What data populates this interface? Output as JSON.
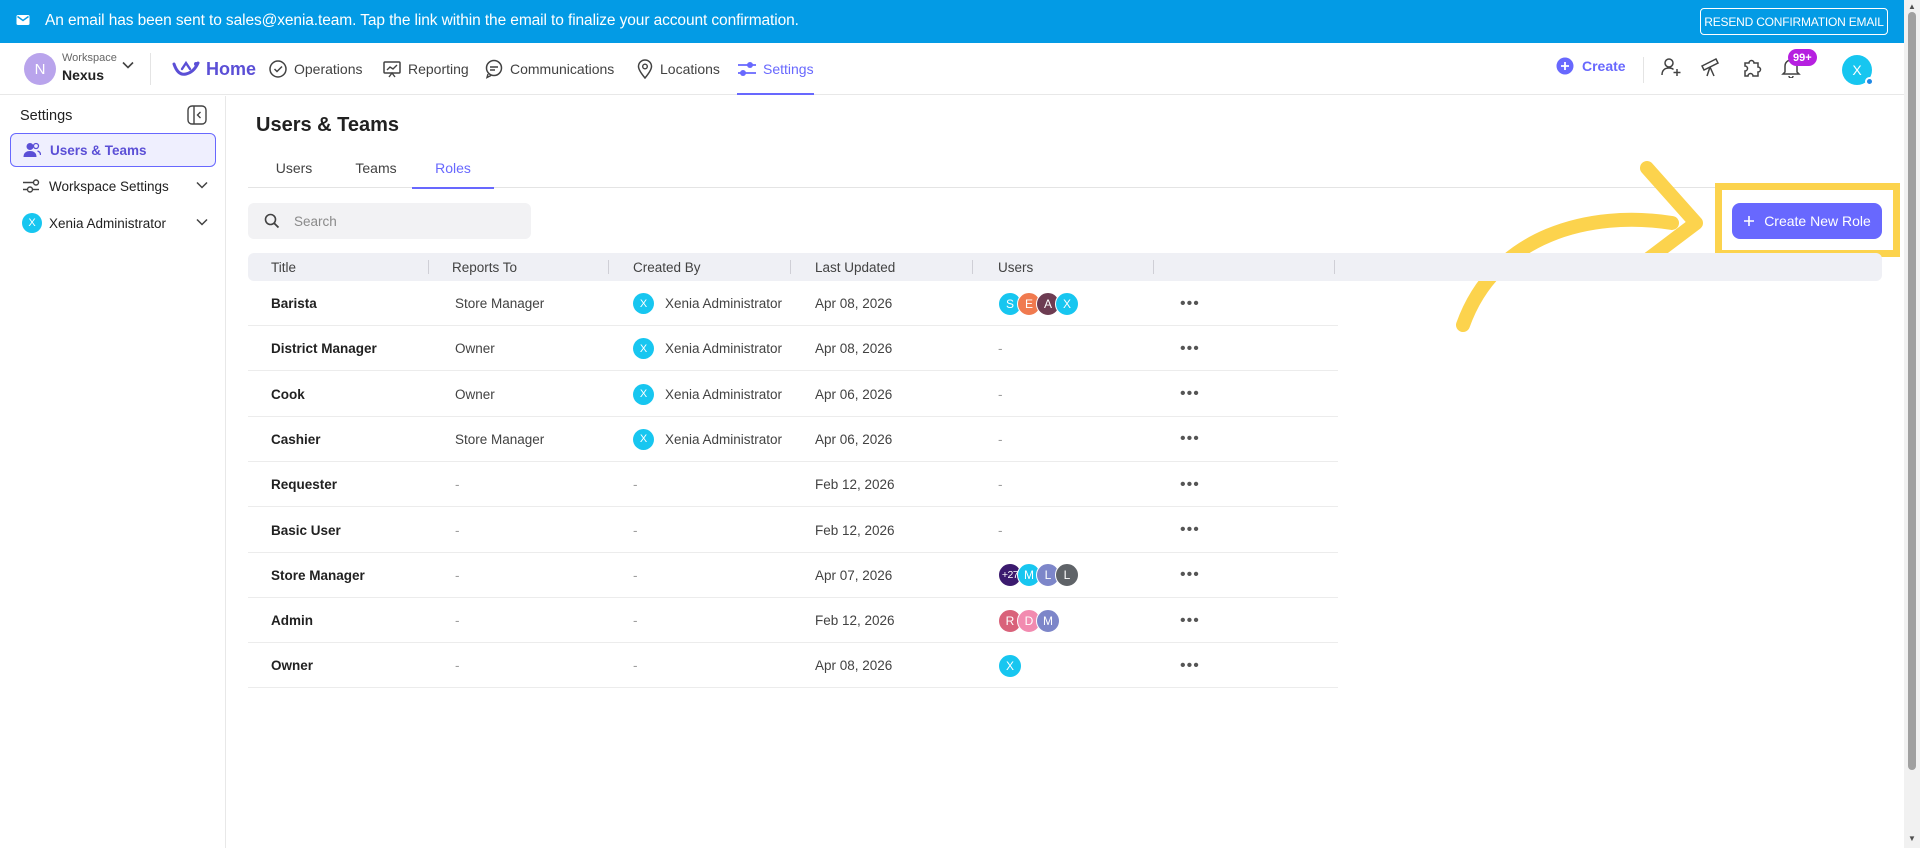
{
  "banner": {
    "message": "An email has been sent to sales@xenia.team. Tap the link within the email to finalize your account confirmation.",
    "resend_label": "RESEND CONFIRMATION EMAIL"
  },
  "navbar": {
    "workspace_label": "Workspace",
    "workspace_name": "Nexus",
    "workspace_initial": "N",
    "home_label": "Home",
    "items": [
      {
        "label": "Operations",
        "icon": "check-circle-icon"
      },
      {
        "label": "Reporting",
        "icon": "presentation-chart-icon"
      },
      {
        "label": "Communications",
        "icon": "chat-icon"
      },
      {
        "label": "Locations",
        "icon": "location-pin-icon"
      },
      {
        "label": "Settings",
        "icon": "settings-sliders-icon"
      }
    ],
    "active_item": "Settings",
    "create_label": "Create",
    "notifications_badge": "99+",
    "user_initial": "X"
  },
  "sidebar": {
    "title": "Settings",
    "items": [
      {
        "label": "Users & Teams",
        "active": true
      },
      {
        "label": "Workspace Settings",
        "active": false
      },
      {
        "label": "Xenia Administrator",
        "active": false,
        "initial": "X"
      }
    ]
  },
  "main": {
    "title": "Users & Teams",
    "tabs": [
      "Users",
      "Teams",
      "Roles"
    ],
    "active_tab": "Roles",
    "search_placeholder": "Search",
    "create_role_label": "Create New Role"
  },
  "table": {
    "columns": [
      "Title",
      "Reports To",
      "Created By",
      "Last Updated",
      "Users"
    ],
    "rows": [
      {
        "title": "Barista",
        "reports_to": "Store Manager",
        "created_by": "Xenia Administrator",
        "creator_initial": "X",
        "last_updated": "Apr 08, 2026",
        "users": [
          {
            "t": "S",
            "c": "#17c6f0"
          },
          {
            "t": "E",
            "c": "#f07a4f"
          },
          {
            "t": "A",
            "c": "#6d3c52"
          },
          {
            "t": "X",
            "c": "#17c6f0"
          }
        ]
      },
      {
        "title": "District Manager",
        "reports_to": "Owner",
        "created_by": "Xenia Administrator",
        "creator_initial": "X",
        "last_updated": "Apr 08, 2026",
        "users_text": "-"
      },
      {
        "title": "Cook",
        "reports_to": "Owner",
        "created_by": "Xenia Administrator",
        "creator_initial": "X",
        "last_updated": "Apr 06, 2026",
        "users_text": "-"
      },
      {
        "title": "Cashier",
        "reports_to": "Store Manager",
        "created_by": "Xenia Administrator",
        "creator_initial": "X",
        "last_updated": "Apr 06, 2026",
        "users_text": "-"
      },
      {
        "title": "Requester",
        "reports_to": "-",
        "created_by": "-",
        "last_updated": "Feb 12, 2026",
        "users_text": "-"
      },
      {
        "title": "Basic User",
        "reports_to": "-",
        "created_by": "-",
        "last_updated": "Feb 12, 2026",
        "users_text": "-"
      },
      {
        "title": "Store Manager",
        "reports_to": "-",
        "created_by": "-",
        "last_updated": "Apr 07, 2026",
        "users": [
          {
            "t": "+27",
            "c": "#3b1a6e",
            "more": true
          },
          {
            "t": "M",
            "c": "#17c6f0"
          },
          {
            "t": "L",
            "c": "#7d86c9"
          },
          {
            "t": "L",
            "c": "#5f6368"
          }
        ]
      },
      {
        "title": "Admin",
        "reports_to": "-",
        "created_by": "-",
        "last_updated": "Feb 12, 2026",
        "users": [
          {
            "t": "R",
            "c": "#d9627a"
          },
          {
            "t": "D",
            "c": "#f28bb0"
          },
          {
            "t": "M",
            "c": "#7d86c9"
          }
        ]
      },
      {
        "title": "Owner",
        "reports_to": "-",
        "created_by": "-",
        "last_updated": "Apr 08, 2026",
        "users": [
          {
            "t": "X",
            "c": "#17c6f0"
          }
        ]
      }
    ],
    "row_action_label": "•••"
  },
  "colors": {
    "banner": "#039be5",
    "accent": "#6868fe",
    "highlight": "#fcd34d"
  }
}
